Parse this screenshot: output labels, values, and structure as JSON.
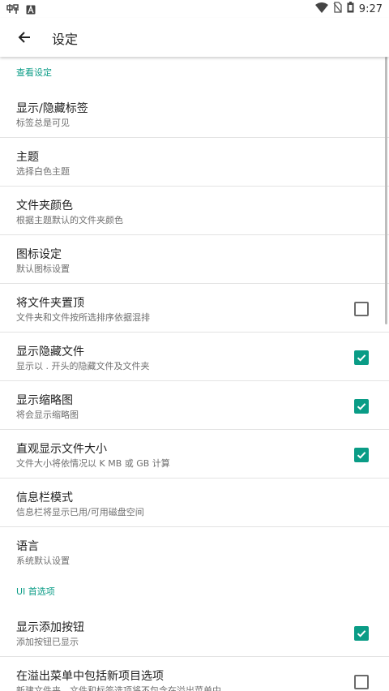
{
  "status": {
    "time": "9:27"
  },
  "appbar": {
    "title": "设定"
  },
  "sections": [
    {
      "header": "查看设定",
      "rows": [
        {
          "title": "显示/隐藏标签",
          "subtitle": "标签总是可见"
        },
        {
          "title": "主题",
          "subtitle": "选择白色主题"
        },
        {
          "title": "文件夹颜色",
          "subtitle": "根据主题默认的文件夹颜色"
        },
        {
          "title": "图标设定",
          "subtitle": "默认图标设置"
        },
        {
          "title": "将文件夹置顶",
          "subtitle": "文件夹和文件按所选排序依据混排",
          "checked": false
        },
        {
          "title": "显示隐藏文件",
          "subtitle": "显示以 . 开头的隐藏文件及文件夹",
          "checked": true
        },
        {
          "title": "显示缩略图",
          "subtitle": "将会显示缩略图",
          "checked": true
        },
        {
          "title": "直观显示文件大小",
          "subtitle": "文件大小将依情况以 K MB 或 GB 计算",
          "checked": true
        },
        {
          "title": "信息栏模式",
          "subtitle": "信息栏将显示已用/可用磁盘空间"
        },
        {
          "title": "语言",
          "subtitle": "系统默认设置"
        }
      ]
    },
    {
      "header": "UI 首选项",
      "rows": [
        {
          "title": "显示添加按钮",
          "subtitle": "添加按钮已显示",
          "checked": true
        },
        {
          "title": "在溢出菜单中包括新项目选项",
          "subtitle": "新建文件夹、文件和标签选项将不包含在溢出菜单中",
          "checked": false
        }
      ]
    }
  ],
  "colors": {
    "accent": "#0a9c86",
    "divider": "#e3e3e3"
  }
}
